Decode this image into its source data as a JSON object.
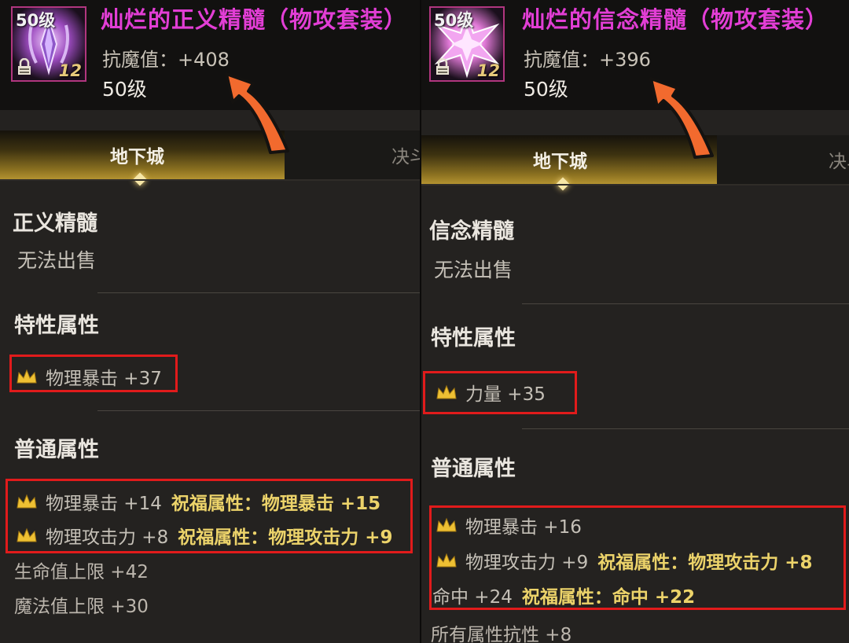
{
  "left": {
    "thumb_level": "50级",
    "thumb_count": "12",
    "item_name": "灿烂的正义精髓（物攻套装）",
    "resist_stat": "抗魔值：+408",
    "item_level": "50级",
    "tab_active": "地下城",
    "tab_inactive": "决斗",
    "essence_name": "正义精髓",
    "trade_status": "无法出售",
    "special_title": "特性属性",
    "special": {
      "text": "物理暴击 +37"
    },
    "normal_title": "普通属性",
    "normal": [
      {
        "text": "物理暴击 +14",
        "bless": "祝福属性：物理暴击 +15"
      },
      {
        "text": "物理攻击力 +8",
        "bless": "祝福属性：物理攻击力 +9"
      }
    ],
    "plain": [
      "生命值上限 +42",
      "魔法值上限 +30"
    ]
  },
  "right": {
    "thumb_level": "50级",
    "thumb_count": "12",
    "item_name": "灿烂的信念精髓（物攻套装）",
    "resist_stat": "抗魔值：+396",
    "item_level": "50级",
    "tab_active": "地下城",
    "tab_inactive": "决斗",
    "essence_name": "信念精髓",
    "trade_status": "无法出售",
    "special_title": "特性属性",
    "special": {
      "text": "力量 +35"
    },
    "normal_title": "普通属性",
    "normal": [
      {
        "text": "物理暴击 +16",
        "bless": ""
      },
      {
        "text": "物理攻击力 +9",
        "bless": "祝福属性：物理攻击力 +8"
      },
      {
        "text": "命中 +24",
        "bless": "祝福属性：命中 +22"
      }
    ],
    "plain": [
      "所有属性抗性 +8"
    ]
  },
  "colors": {
    "item_name": "#e23ed5",
    "highlight_box": "#e11b1b",
    "annotation_arrow": "#f26a2e",
    "bless_text": "#ecd36a"
  },
  "icons": [
    "crown-icon",
    "lock-icon",
    "essence-crystal-icon",
    "annotation-arrow-icon"
  ]
}
